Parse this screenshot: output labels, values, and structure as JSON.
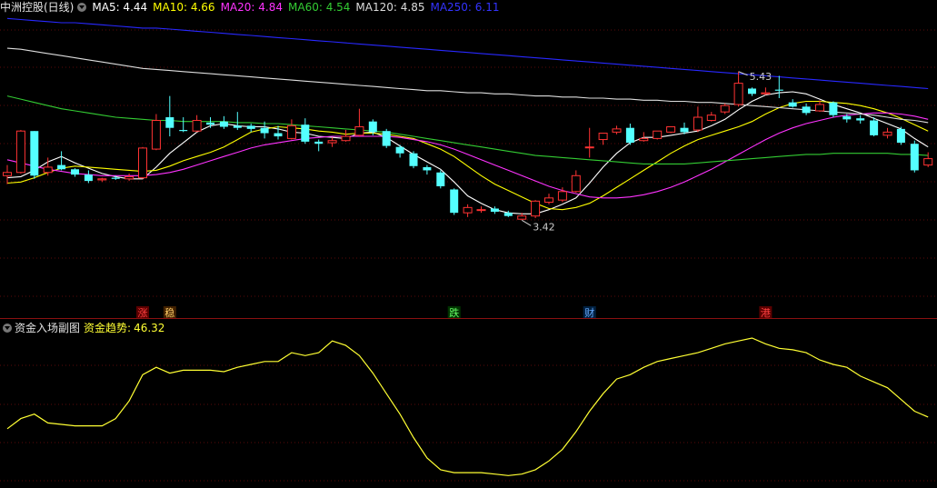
{
  "main_legend": {
    "stock": "中洲控股(日线)",
    "ma": [
      {
        "label": "MA5: 4.44",
        "color": "#ffffff"
      },
      {
        "label": "MA10: 4.66",
        "color": "#ffff00"
      },
      {
        "label": "MA20: 4.84",
        "color": "#ff33ff"
      },
      {
        "label": "MA60: 4.54",
        "color": "#33cc33"
      },
      {
        "label": "MA120: 4.85",
        "color": "#dddddd"
      },
      {
        "label": "MA250: 6.11",
        "color": "#3333ff"
      }
    ]
  },
  "sub_legend": {
    "title": "资金入场副图",
    "indicator_label": "资金趋势:",
    "indicator_value": "46.32"
  },
  "annotations": {
    "high": "5.43",
    "low": "3.42",
    "markers": [
      {
        "text": "涨",
        "index": 10,
        "bg": "#5a0000",
        "color": "#ff4040"
      },
      {
        "text": "稳",
        "index": 12,
        "bg": "#402000",
        "color": "#ffcc66"
      },
      {
        "text": "跌",
        "index": 33,
        "bg": "#003300",
        "color": "#66ff66"
      },
      {
        "text": "财",
        "index": 43,
        "bg": "#002040",
        "color": "#66aaff"
      },
      {
        "text": "港",
        "index": 56,
        "bg": "#5a0000",
        "color": "#ff4040"
      }
    ]
  },
  "chart_data": [
    {
      "type": "candlestick",
      "ylim": [
        3.28,
        5.95
      ],
      "candles_ohlc": [
        [
          4.45,
          4.55,
          4.48,
          4.37
        ],
        [
          4.48,
          4.88,
          4.87,
          4.47
        ],
        [
          4.87,
          4.87,
          4.45,
          4.42
        ],
        [
          4.48,
          4.62,
          4.53,
          4.45
        ],
        [
          4.55,
          4.68,
          4.51,
          4.5
        ],
        [
          4.51,
          4.52,
          4.46,
          4.44
        ],
        [
          4.46,
          4.5,
          4.4,
          4.38
        ],
        [
          4.41,
          4.43,
          4.42,
          4.39
        ],
        [
          4.43,
          4.45,
          4.42,
          4.41
        ],
        [
          4.42,
          4.47,
          4.44,
          4.4
        ],
        [
          4.43,
          4.72,
          4.71,
          4.42
        ],
        [
          4.7,
          5.03,
          4.97,
          4.69
        ],
        [
          5.0,
          5.2,
          4.9,
          4.82
        ],
        [
          4.88,
          5.0,
          4.87,
          4.86
        ],
        [
          4.87,
          5.02,
          4.97,
          4.86
        ],
        [
          4.95,
          5.0,
          4.93,
          4.9
        ],
        [
          4.96,
          5.01,
          4.91,
          4.89
        ],
        [
          4.92,
          5.05,
          4.9,
          4.88
        ],
        [
          4.92,
          4.94,
          4.89,
          4.86
        ],
        [
          4.9,
          4.96,
          4.85,
          4.8
        ],
        [
          4.85,
          4.92,
          4.82,
          4.79
        ],
        [
          4.8,
          4.98,
          4.92,
          4.79
        ],
        [
          4.93,
          4.99,
          4.77,
          4.75
        ],
        [
          4.77,
          4.79,
          4.75,
          4.68
        ],
        [
          4.76,
          4.81,
          4.78,
          4.72
        ],
        [
          4.78,
          4.88,
          4.82,
          4.77
        ],
        [
          4.83,
          5.08,
          4.91,
          4.82
        ],
        [
          4.96,
          4.98,
          4.86,
          4.83
        ],
        [
          4.87,
          4.89,
          4.73,
          4.71
        ],
        [
          4.72,
          4.74,
          4.66,
          4.62
        ],
        [
          4.66,
          4.68,
          4.54,
          4.52
        ],
        [
          4.53,
          4.55,
          4.5,
          4.46
        ],
        [
          4.48,
          4.5,
          4.35,
          4.33
        ],
        [
          4.32,
          4.33,
          4.1,
          4.08
        ],
        [
          4.1,
          4.18,
          4.15,
          4.06
        ],
        [
          4.13,
          4.16,
          4.13,
          4.1
        ],
        [
          4.14,
          4.16,
          4.11,
          4.09
        ],
        [
          4.1,
          4.12,
          4.07,
          4.06
        ],
        [
          4.04,
          4.1,
          4.07,
          4.03
        ],
        [
          4.07,
          4.22,
          4.21,
          4.05
        ],
        [
          4.2,
          4.28,
          4.24,
          4.18
        ],
        [
          4.22,
          4.34,
          4.3,
          4.2
        ],
        [
          4.3,
          4.5,
          4.45,
          4.29
        ],
        [
          4.72,
          4.9,
          4.72,
          4.62
        ],
        [
          4.79,
          4.82,
          4.85,
          4.74
        ],
        [
          4.86,
          4.92,
          4.89,
          4.84
        ],
        [
          4.9,
          4.94,
          4.76,
          4.74
        ],
        [
          4.78,
          4.86,
          4.8,
          4.77
        ],
        [
          4.8,
          4.86,
          4.87,
          4.79
        ],
        [
          4.86,
          4.9,
          4.91,
          4.85
        ],
        [
          4.9,
          4.95,
          4.86,
          4.84
        ],
        [
          4.88,
          5.1,
          5.0,
          4.86
        ],
        [
          4.97,
          5.05,
          5.02,
          4.96
        ],
        [
          5.05,
          5.13,
          5.11,
          5.03
        ],
        [
          5.12,
          5.43,
          5.32,
          5.1
        ],
        [
          5.27,
          5.28,
          5.22,
          5.2
        ],
        [
          5.22,
          5.28,
          5.23,
          5.21
        ],
        [
          5.26,
          5.39,
          5.25,
          5.18
        ],
        [
          5.14,
          5.17,
          5.1,
          5.09
        ],
        [
          5.1,
          5.13,
          5.04,
          5.02
        ],
        [
          5.06,
          5.16,
          5.12,
          5.05
        ],
        [
          5.14,
          5.15,
          5.02,
          5.0
        ],
        [
          5.01,
          5.03,
          4.98,
          4.95
        ],
        [
          4.99,
          5.02,
          4.97,
          4.94
        ],
        [
          4.97,
          5.0,
          4.83,
          4.82
        ],
        [
          4.83,
          4.9,
          4.86,
          4.8
        ],
        [
          4.89,
          4.91,
          4.76,
          4.74
        ],
        [
          4.75,
          4.78,
          4.5,
          4.48
        ],
        [
          4.55,
          4.67,
          4.61,
          4.53
        ]
      ],
      "series": [
        {
          "name": "MA5",
          "color": "#ffffff",
          "values": [
            4.43,
            4.44,
            4.5,
            4.58,
            4.63,
            4.57,
            4.52,
            4.47,
            4.44,
            4.42,
            4.42,
            4.53,
            4.66,
            4.76,
            4.86,
            4.92,
            4.94,
            4.92,
            4.91,
            4.91,
            4.89,
            4.86,
            4.85,
            4.82,
            4.81,
            4.8,
            4.85,
            4.86,
            4.81,
            4.73,
            4.65,
            4.58,
            4.51,
            4.39,
            4.26,
            4.19,
            4.13,
            4.1,
            4.09,
            4.09,
            4.13,
            4.18,
            4.24,
            4.38,
            4.53,
            4.66,
            4.76,
            4.81,
            4.81,
            4.83,
            4.85,
            4.87,
            4.92,
            4.98,
            5.07,
            5.15,
            5.21,
            5.23,
            5.24,
            5.22,
            5.17,
            5.12,
            5.08,
            5.04,
            4.99,
            4.94,
            4.89,
            4.8,
            4.72
          ]
        },
        {
          "name": "MA10",
          "color": "#ffff00",
          "values": [
            4.38,
            4.39,
            4.43,
            4.48,
            4.52,
            4.54,
            4.53,
            4.52,
            4.51,
            4.5,
            4.49,
            4.5,
            4.54,
            4.59,
            4.63,
            4.67,
            4.72,
            4.79,
            4.86,
            4.89,
            4.91,
            4.9,
            4.89,
            4.87,
            4.86,
            4.84,
            4.85,
            4.85,
            4.84,
            4.82,
            4.8,
            4.75,
            4.7,
            4.63,
            4.54,
            4.45,
            4.37,
            4.31,
            4.25,
            4.19,
            4.14,
            4.13,
            4.15,
            4.19,
            4.26,
            4.34,
            4.42,
            4.5,
            4.58,
            4.66,
            4.73,
            4.79,
            4.83,
            4.87,
            4.91,
            4.96,
            5.03,
            5.09,
            5.13,
            5.15,
            5.15,
            5.14,
            5.13,
            5.11,
            5.08,
            5.04,
            4.99,
            4.93,
            4.87
          ]
        },
        {
          "name": "MA20",
          "color": "#ff33ff",
          "values": [
            4.6,
            4.57,
            4.54,
            4.51,
            4.49,
            4.47,
            4.46,
            4.45,
            4.45,
            4.45,
            4.45,
            4.46,
            4.48,
            4.51,
            4.55,
            4.59,
            4.63,
            4.67,
            4.71,
            4.74,
            4.76,
            4.78,
            4.8,
            4.81,
            4.82,
            4.82,
            4.82,
            4.82,
            4.82,
            4.81,
            4.79,
            4.77,
            4.74,
            4.7,
            4.65,
            4.6,
            4.55,
            4.5,
            4.45,
            4.4,
            4.35,
            4.31,
            4.28,
            4.25,
            4.24,
            4.24,
            4.25,
            4.27,
            4.3,
            4.34,
            4.39,
            4.45,
            4.51,
            4.58,
            4.65,
            4.72,
            4.79,
            4.85,
            4.9,
            4.94,
            4.97,
            5.0,
            5.02,
            5.03,
            5.04,
            5.04,
            5.03,
            5.01,
            4.98
          ]
        },
        {
          "name": "MA60",
          "color": "#33cc33",
          "values": [
            5.2,
            5.17,
            5.14,
            5.11,
            5.08,
            5.06,
            5.04,
            5.02,
            5.0,
            4.99,
            4.98,
            4.97,
            4.97,
            4.96,
            4.96,
            4.96,
            4.96,
            4.95,
            4.95,
            4.94,
            4.94,
            4.93,
            4.92,
            4.91,
            4.9,
            4.89,
            4.88,
            4.87,
            4.86,
            4.84,
            4.82,
            4.8,
            4.78,
            4.76,
            4.74,
            4.72,
            4.7,
            4.68,
            4.66,
            4.64,
            4.63,
            4.62,
            4.61,
            4.6,
            4.59,
            4.58,
            4.57,
            4.56,
            4.56,
            4.56,
            4.56,
            4.57,
            4.58,
            4.59,
            4.6,
            4.61,
            4.62,
            4.63,
            4.64,
            4.65,
            4.65,
            4.66,
            4.66,
            4.66,
            4.66,
            4.66,
            4.65,
            4.65,
            4.64
          ]
        },
        {
          "name": "MA120",
          "color": "#dddddd",
          "values": [
            5.65,
            5.64,
            5.62,
            5.6,
            5.58,
            5.56,
            5.54,
            5.52,
            5.5,
            5.48,
            5.46,
            5.45,
            5.44,
            5.43,
            5.42,
            5.41,
            5.4,
            5.39,
            5.38,
            5.37,
            5.36,
            5.35,
            5.34,
            5.33,
            5.32,
            5.31,
            5.3,
            5.29,
            5.28,
            5.27,
            5.26,
            5.25,
            5.25,
            5.24,
            5.23,
            5.23,
            5.22,
            5.22,
            5.21,
            5.2,
            5.2,
            5.19,
            5.19,
            5.18,
            5.18,
            5.17,
            5.17,
            5.16,
            5.16,
            5.15,
            5.15,
            5.14,
            5.14,
            5.13,
            5.12,
            5.11,
            5.1,
            5.09,
            5.08,
            5.07,
            5.06,
            5.05,
            5.04,
            5.03,
            5.02,
            5.0,
            4.98,
            4.97,
            4.95
          ]
        },
        {
          "name": "MA250",
          "color": "#2828ff",
          "values": [
            5.93,
            5.92,
            5.91,
            5.9,
            5.89,
            5.89,
            5.88,
            5.87,
            5.86,
            5.85,
            5.84,
            5.84,
            5.83,
            5.82,
            5.81,
            5.8,
            5.79,
            5.78,
            5.77,
            5.76,
            5.75,
            5.74,
            5.73,
            5.72,
            5.71,
            5.7,
            5.69,
            5.68,
            5.67,
            5.66,
            5.65,
            5.64,
            5.63,
            5.62,
            5.61,
            5.6,
            5.59,
            5.58,
            5.57,
            5.56,
            5.55,
            5.54,
            5.53,
            5.52,
            5.51,
            5.5,
            5.49,
            5.48,
            5.47,
            5.46,
            5.45,
            5.44,
            5.43,
            5.42,
            5.41,
            5.4,
            5.39,
            5.38,
            5.37,
            5.36,
            5.35,
            5.34,
            5.33,
            5.32,
            5.31,
            5.3,
            5.29,
            5.28,
            5.27
          ]
        }
      ]
    },
    {
      "type": "line",
      "name": "资金趋势",
      "color": "#ffff33",
      "ylim": [
        0,
        100
      ],
      "values": [
        38,
        45,
        48,
        42,
        41,
        40,
        40,
        40,
        45,
        57,
        75,
        80,
        76,
        78,
        78,
        78,
        77,
        80,
        82,
        84,
        84,
        90,
        88,
        90,
        98,
        95,
        88,
        76,
        62,
        48,
        32,
        18,
        10,
        8,
        8,
        8,
        7,
        6,
        7,
        10,
        16,
        24,
        36,
        50,
        62,
        72,
        75,
        80,
        84,
        86,
        88,
        90,
        93,
        96,
        98,
        100,
        96,
        93,
        92,
        90,
        85,
        82,
        80,
        74,
        70,
        66,
        58,
        50,
        46
      ]
    }
  ]
}
